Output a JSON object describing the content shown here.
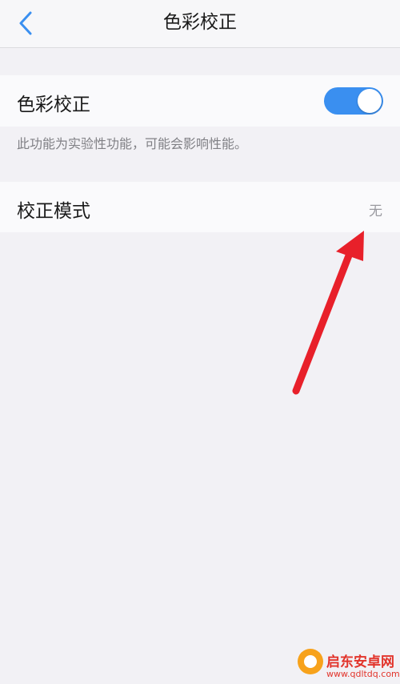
{
  "nav": {
    "title": "色彩校正",
    "back_icon": "chevron-left-icon"
  },
  "color_correction": {
    "label": "色彩校正",
    "enabled": true,
    "toggle_color": "#3a8ff0",
    "hint": "此功能为实验性功能，可能会影响性能。"
  },
  "correction_mode": {
    "label": "校正模式",
    "value": "无"
  },
  "annotation": {
    "arrow_color": "#e8202a"
  },
  "watermark": {
    "title": "启东安卓网",
    "url": "www.qdltdq.com"
  }
}
